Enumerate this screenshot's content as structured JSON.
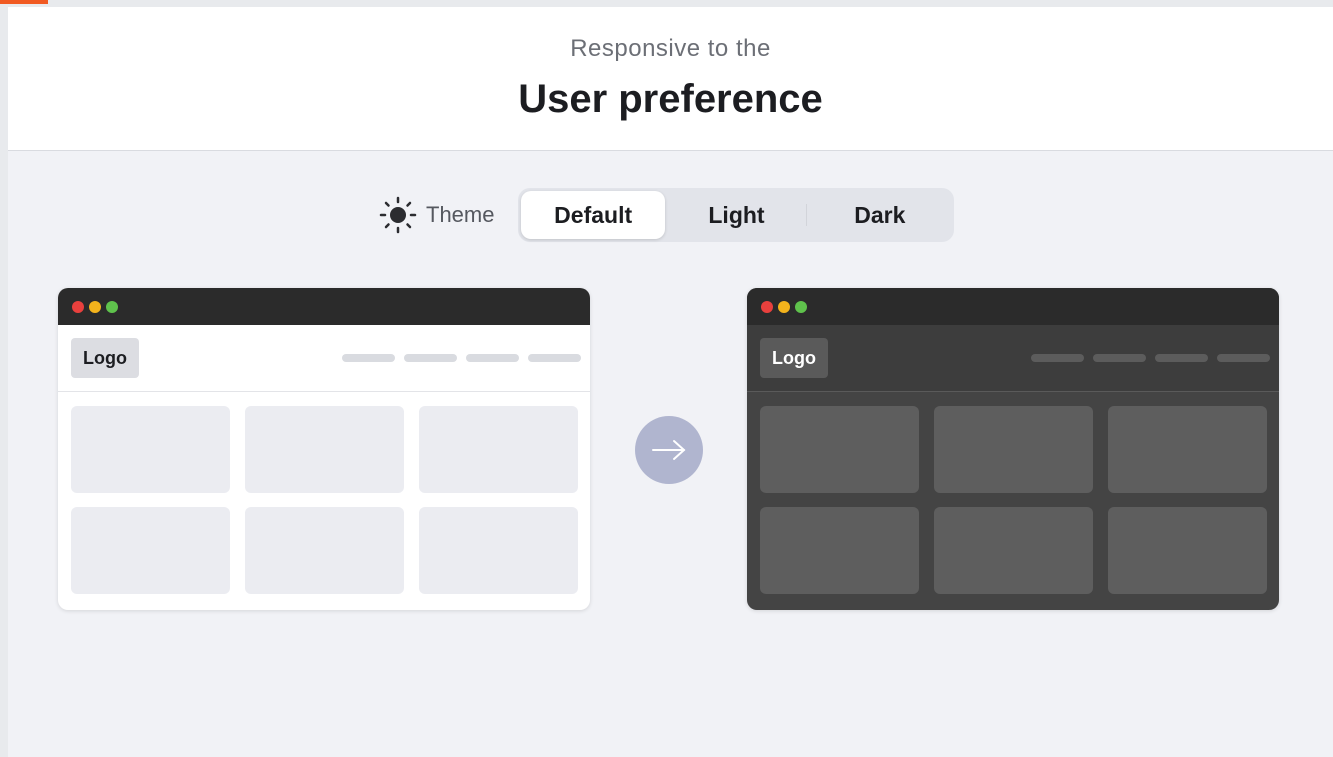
{
  "header": {
    "subtitle": "Responsive to the",
    "title": "User preference"
  },
  "theme": {
    "icon": "sun-icon",
    "label": "Theme",
    "options": [
      "Default",
      "Light",
      "Dark"
    ],
    "selected": "Default"
  },
  "preview_light": {
    "logo": "Logo",
    "mode": "light"
  },
  "preview_dark": {
    "logo": "Logo",
    "mode": "dark"
  },
  "arrow": {
    "icon": "arrow-right-icon"
  },
  "colors": {
    "accent_corner": "#f15a22",
    "arrow_bg": "#b0b5cf",
    "dark_window": "#444444",
    "traffic_red": "#e9403d",
    "traffic_yellow": "#f3b31c",
    "traffic_green": "#5fc24c"
  }
}
